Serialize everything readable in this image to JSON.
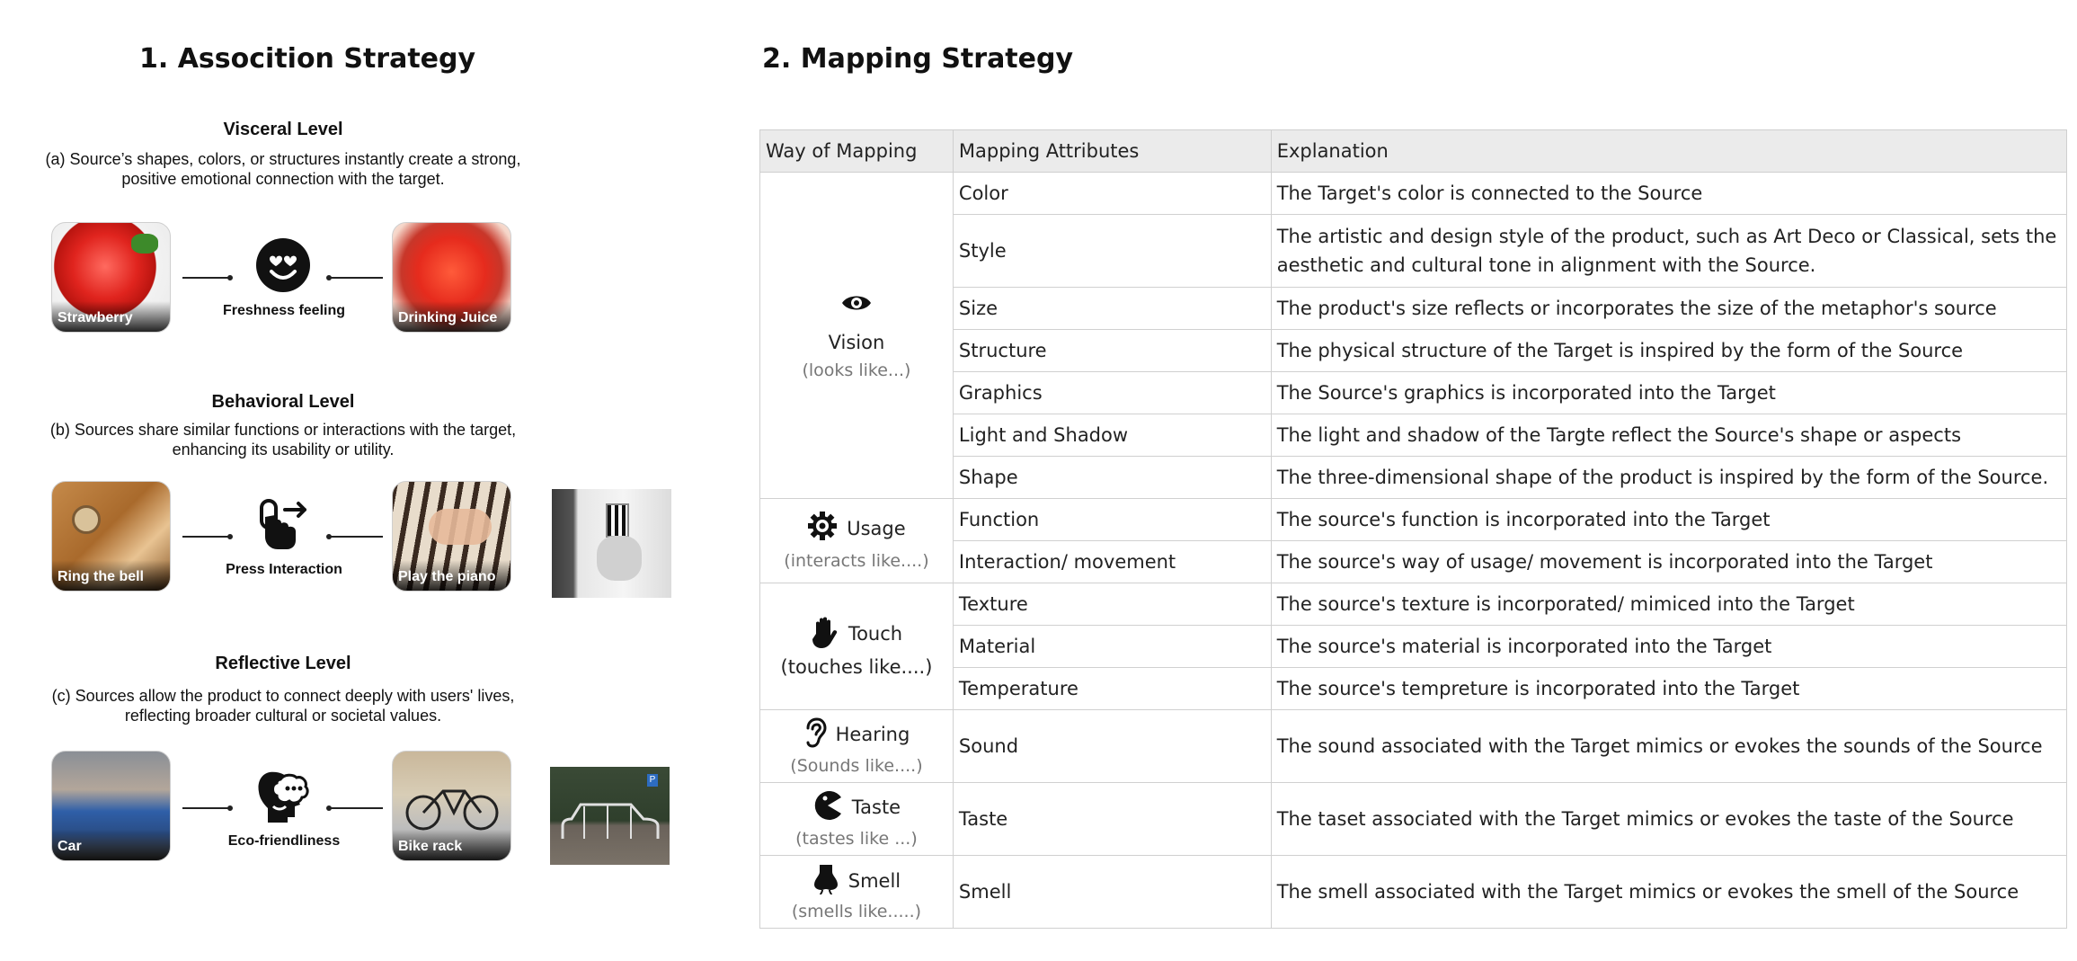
{
  "left": {
    "title": "1. Assocition Strategy",
    "levels": [
      {
        "title": "Visceral Level",
        "description": "(a) Source’s shapes, colors, or structures instantly create a strong, positive emotional connection with the target.",
        "source_label": "Strawberry",
        "center_label": "Freshness feeling",
        "target_label": "Drinking Juice",
        "center_icon": "smiley-heart-eyes-icon"
      },
      {
        "title": "Behavioral Level",
        "description": "(b) Sources share similar functions or interactions with the target, enhancing its usability or utility.",
        "source_label": "Ring the bell",
        "center_label": "Press Interaction",
        "target_label": "Play the piano",
        "center_icon": "finger-press-icon"
      },
      {
        "title": "Reflective Level",
        "description": "(c) Sources allow the product to connect deeply with users' lives, reflecting broader cultural or societal values.",
        "source_label": "Car",
        "center_label": "Eco-friendliness",
        "target_label": "Bike rack",
        "center_icon": "thinking-head-icon"
      }
    ]
  },
  "right": {
    "title": "2. Mapping Strategy",
    "headers": [
      "Way of Mapping",
      "Mapping Attributes",
      "Explanation"
    ],
    "groups": [
      {
        "way": "Vision",
        "way_sub": "(looks like...)",
        "icon": "eye-icon",
        "rows": [
          {
            "attr": "Color",
            "exp": "The Target's color is connected to the Source"
          },
          {
            "attr": "Style",
            "exp": "The artistic and design style of the product, such as Art Deco or Classical, sets the aesthetic and cultural tone in alignment with the Source."
          },
          {
            "attr": "Size",
            "exp": "The product's size reflects or incorporates the size of the metaphor's source"
          },
          {
            "attr": "Structure",
            "exp": "The physical structure of the Target is inspired by the form of the Source"
          },
          {
            "attr": "Graphics",
            "exp": "The Source's graphics is incorporated into the Target"
          },
          {
            "attr": "Light and Shadow",
            "exp": "The light and shadow of the Targte reflect the Source's shape or aspects"
          },
          {
            "attr": "Shape",
            "exp": "The three-dimensional shape of the product is inspired by the form of the Source."
          }
        ]
      },
      {
        "way": "Usage",
        "way_sub": "(interacts like....)",
        "icon": "gear-icon",
        "rows": [
          {
            "attr": "Function",
            "exp": "The source's function is incorporated into the Target"
          },
          {
            "attr": "Interaction/ movement",
            "exp": "The source's way of usage/ movement is incorporated into the Target"
          }
        ]
      },
      {
        "way": "Touch",
        "way_sub": "(touches like....)",
        "icon": "hand-icon",
        "rows": [
          {
            "attr": "Texture",
            "exp": "The source's texture is incorporated/ mimiced into the Target"
          },
          {
            "attr": "Material",
            "exp": "The source's material is incorporated into the Target"
          },
          {
            "attr": "Temperature",
            "exp": "The source's tempreture is incorporated into the Target"
          }
        ]
      },
      {
        "way": "Hearing",
        "way_sub": "(Sounds like....)",
        "icon": "ear-icon",
        "rows": [
          {
            "attr": "Sound",
            "exp": "The sound associated with the Target mimics or evokes the sounds of the Source"
          }
        ]
      },
      {
        "way": "Taste",
        "way_sub": "(tastes like ...)",
        "icon": "mouth-icon",
        "rows": [
          {
            "attr": "Taste",
            "exp": "The taset associated with the Target mimics or evokes the taste of the Source"
          }
        ]
      },
      {
        "way": "Smell",
        "way_sub": "(smells like.....)",
        "icon": "nose-icon",
        "rows": [
          {
            "attr": "Smell",
            "exp": "The smell associated with the Target mimics or evokes the smell of the Source"
          }
        ]
      }
    ]
  }
}
